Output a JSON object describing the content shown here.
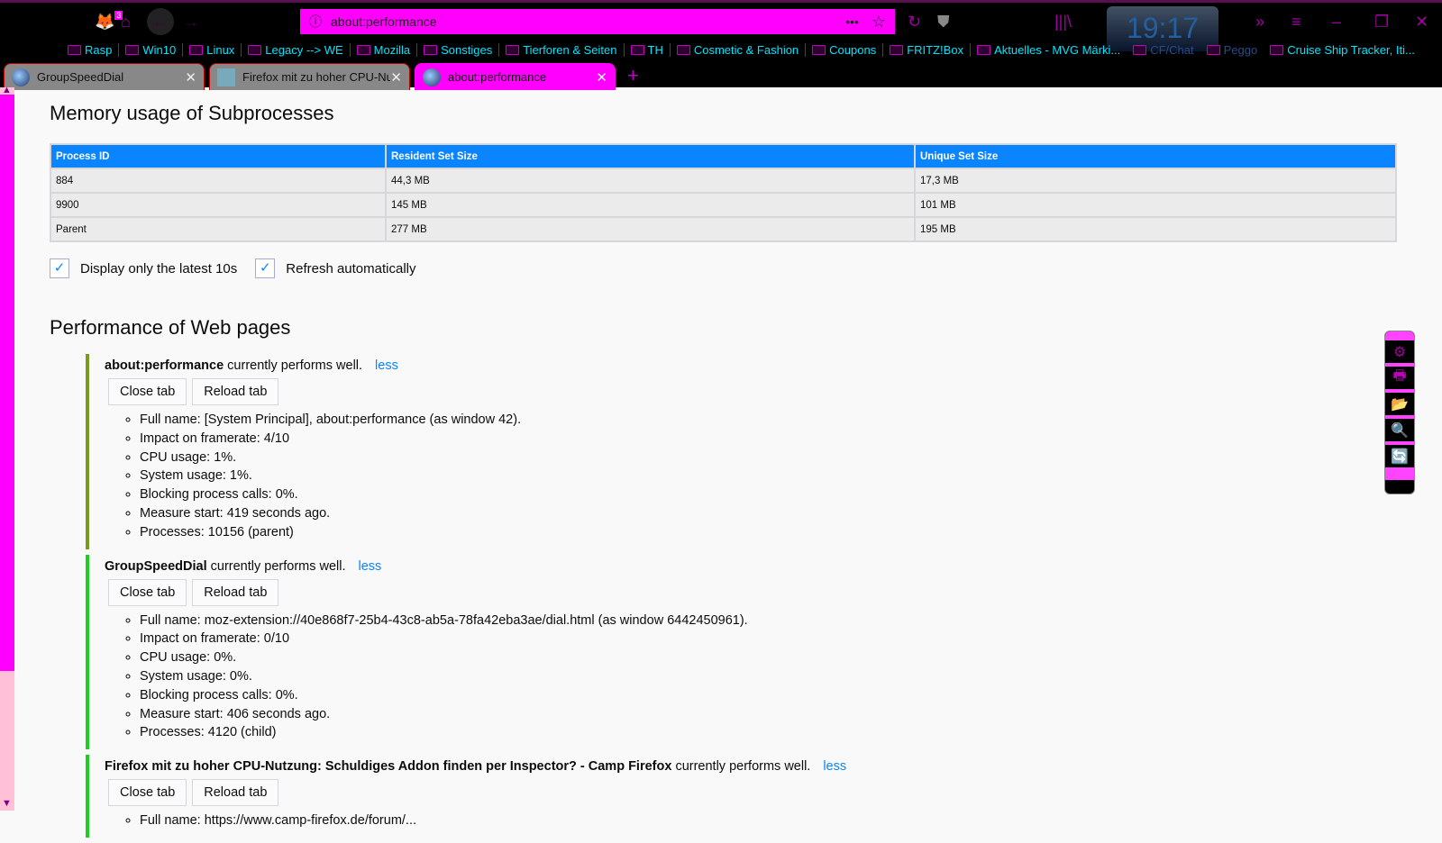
{
  "toolbar": {
    "badge": "3",
    "url": "about:performance",
    "clock": "19:17"
  },
  "bookmarks": [
    "Rasp",
    "Win10",
    "Linux",
    "Legacy --> WE",
    "Mozilla",
    "Sonstiges",
    "Tierforen & Seiten",
    "TH",
    "Cosmetic & Fashion",
    "Coupons",
    "FRITZ!Box",
    "Aktuelles - MVG Märki...",
    "CF/Chat",
    "Peggo",
    "Cruise Ship Tracker, Iti..."
  ],
  "tabs": [
    {
      "title": "GroupSpeedDial"
    },
    {
      "title": "Firefox mit zu hoher CPU-Nutzung"
    },
    {
      "title": "about:performance"
    }
  ],
  "memory": {
    "title": "Memory usage of Subprocesses",
    "headers": [
      "Process ID",
      "Resident Set Size",
      "Unique Set Size"
    ],
    "rows": [
      [
        "884",
        "44,3 MB",
        "17,3 MB"
      ],
      [
        "9900",
        "145 MB",
        "101 MB"
      ],
      [
        "Parent",
        "277 MB",
        "195 MB"
      ]
    ],
    "opt1": "Display only the latest 10s",
    "opt2": "Refresh automatically"
  },
  "perf": {
    "title": "Performance of Web pages",
    "status": "currently performs well.",
    "less": "less",
    "close": "Close tab",
    "reload": "Reload tab",
    "entries": [
      {
        "name": "about:performance",
        "details": [
          "Full name: [System Principal], about:performance (as window 42).",
          "Impact on framerate: 4/10",
          "CPU usage: 1%.",
          "System usage: 1%.",
          "Blocking process calls: 0%.",
          "Measure start: 419 seconds ago.",
          "Processes: 10156 (parent)"
        ]
      },
      {
        "name": "GroupSpeedDial",
        "details": [
          "Full name: moz-extension://40e868f7-25b4-43c8-ab5a-78fa42eba3ae/dial.html (as window 6442450961).",
          "Impact on framerate: 0/10",
          "CPU usage: 0%.",
          "System usage: 0%.",
          "Blocking process calls: 0%.",
          "Measure start: 406 seconds ago.",
          "Processes: 4120 (child)"
        ]
      },
      {
        "name": "Firefox mit zu hoher CPU-Nutzung: Schuldiges Addon finden per Inspector? - Camp Firefox",
        "details": [
          "Full name: https://www.camp-firefox.de/forum/..."
        ]
      }
    ]
  }
}
